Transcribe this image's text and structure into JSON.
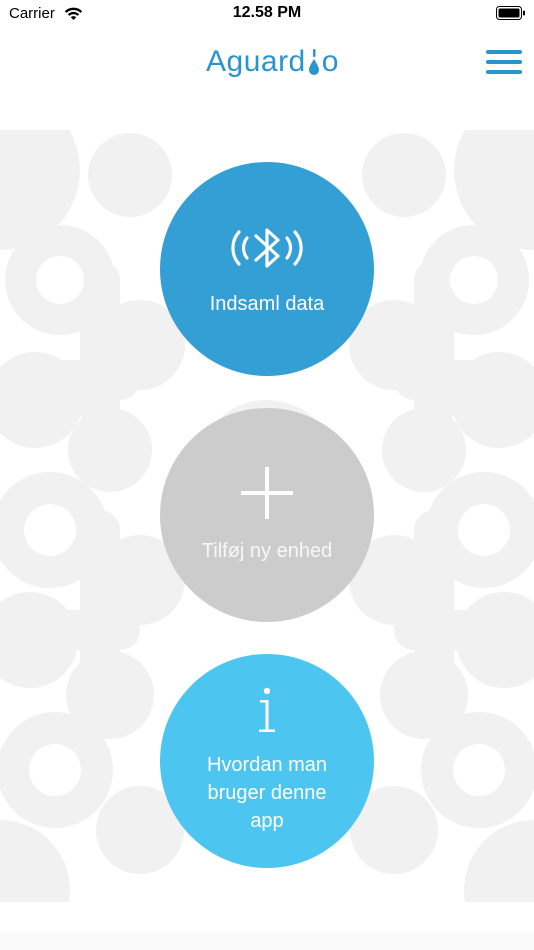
{
  "status_bar": {
    "carrier": "Carrier",
    "time": "12.58 PM"
  },
  "header": {
    "logo_text_left": "Aguard",
    "logo_text_right": "o",
    "accent_color": "#2a94cf"
  },
  "buttons": {
    "collect": {
      "label": "Indsaml data",
      "icon": "bluetooth-signal-icon",
      "color": "#339fd5"
    },
    "add": {
      "label": "Tilføj ny enhed",
      "icon": "plus-icon",
      "color": "#cccccc"
    },
    "info": {
      "label": "Hvordan man bruger denne app",
      "icon": "info-icon",
      "color": "#4cc5f0"
    }
  }
}
